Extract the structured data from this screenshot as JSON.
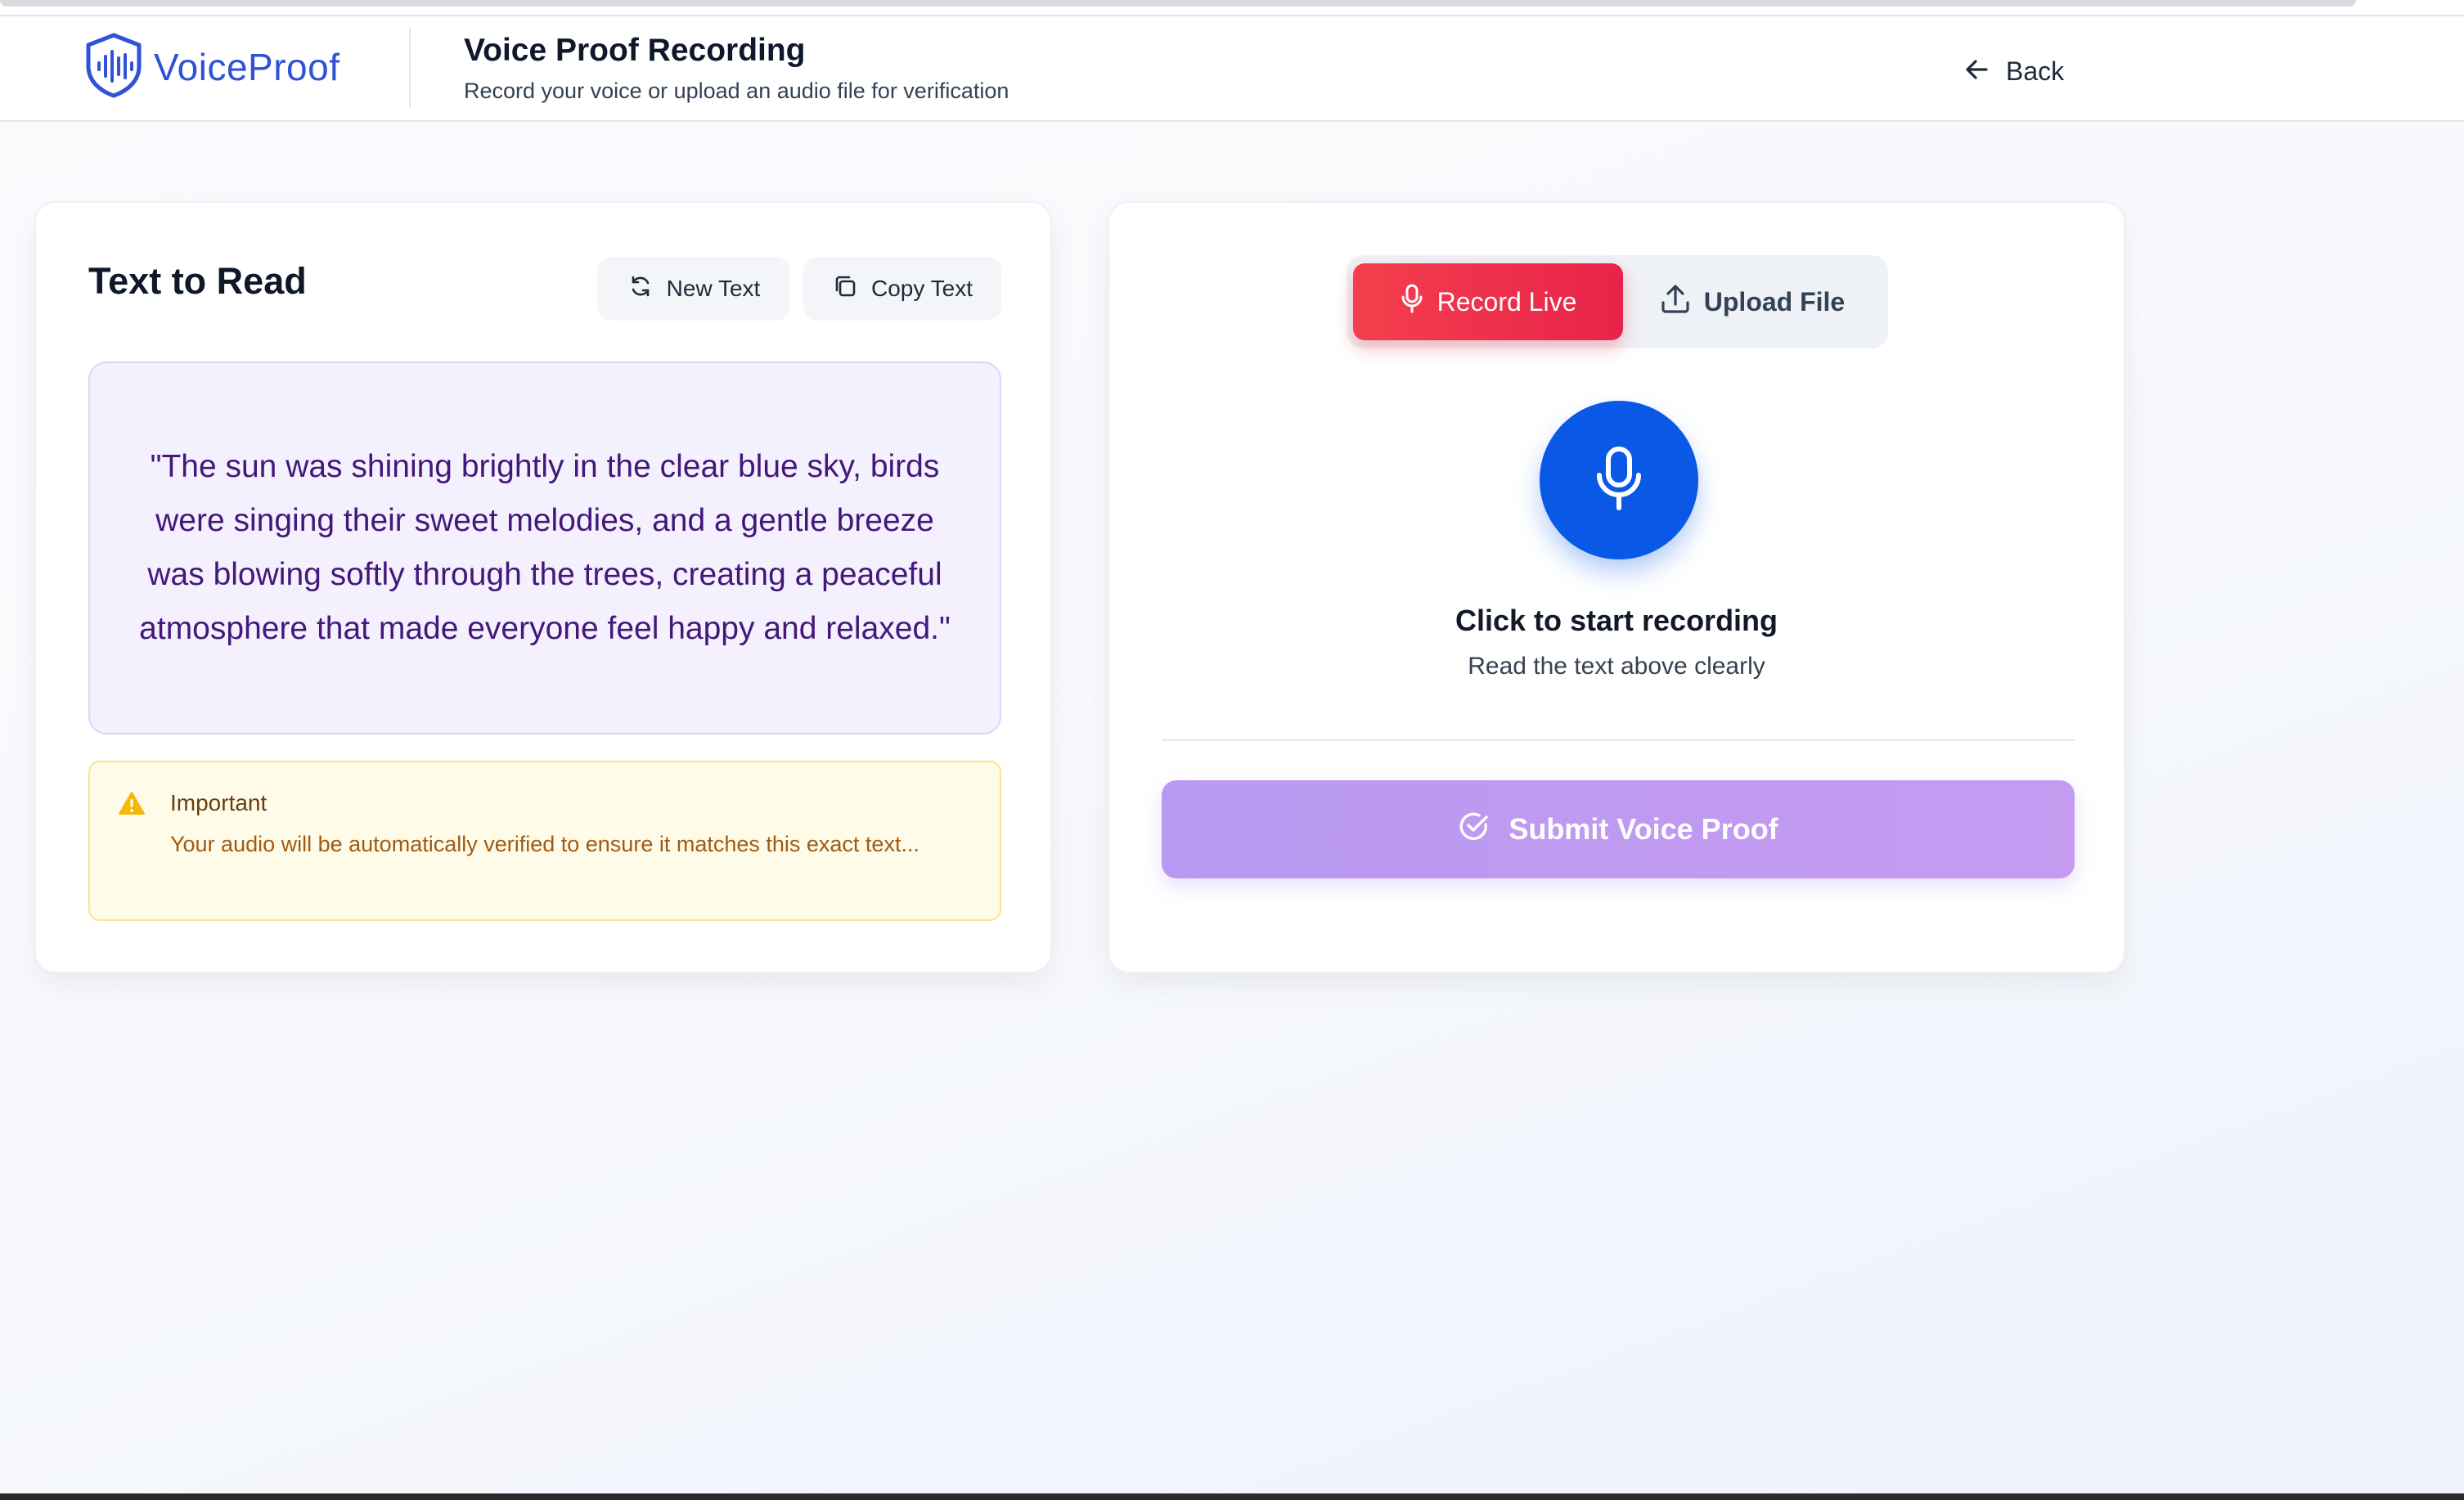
{
  "brand": {
    "name": "VoiceProof",
    "accent": "#2f52d6"
  },
  "header": {
    "title": "Voice Proof Recording",
    "subtitle": "Record your voice or upload an audio file for verification",
    "back_label": "Back"
  },
  "text_card": {
    "title": "Text to Read",
    "new_text_label": "New Text",
    "copy_text_label": "Copy Text",
    "quote": "\"The sun was shining brightly in the clear blue sky, birds were singing their sweet melodies, and a gentle breeze was blowing softly through the trees, creating a peaceful atmosphere that made everyone feel happy and relaxed.\"",
    "notice": {
      "title": "Important",
      "body": "Your audio will be automatically verified to ensure it matches this exact text..."
    }
  },
  "record_card": {
    "modes": [
      {
        "label": "Record Live",
        "active": true,
        "icon": "microphone-icon"
      },
      {
        "label": "Upload File",
        "active": false,
        "icon": "upload-icon"
      }
    ],
    "prompt_title": "Click to start recording",
    "prompt_subtitle": "Read the text above clearly",
    "submit_label": "Submit Voice Proof"
  },
  "colors": {
    "record_active": "#ef3a4f",
    "mic_button": "#0a58e6",
    "submit_button": "#c09af1",
    "quote_text": "#43187a",
    "notice_bg": "#fefbe8"
  }
}
